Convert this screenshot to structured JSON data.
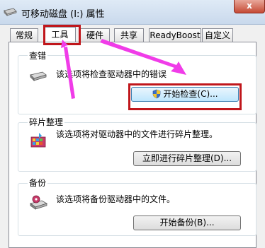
{
  "window": {
    "title": "可移动磁盘 (I:) 属性",
    "close_label": "x"
  },
  "tabs": [
    {
      "label": "常规",
      "active": false
    },
    {
      "label": "工具",
      "active": true
    },
    {
      "label": "硬件",
      "active": false
    },
    {
      "label": "共享",
      "active": false
    },
    {
      "label": "ReadyBoost",
      "active": false
    },
    {
      "label": "自定义",
      "active": false
    }
  ],
  "sections": {
    "error_check": {
      "title": "查错",
      "description": "该选项将检查驱动器中的错误",
      "button": "开始检查(C)..."
    },
    "defrag": {
      "title": "碎片整理",
      "description": "该选项将对驱动器中的文件进行碎片整理。",
      "button": "立即进行碎片整理(D)..."
    },
    "backup": {
      "title": "备份",
      "description": "该选项将备份驱动器中的文件。",
      "button": "开始备份(B)..."
    }
  },
  "colors": {
    "highlight_red": "#c0161b",
    "annotation_magenta": "#f03ce8"
  }
}
